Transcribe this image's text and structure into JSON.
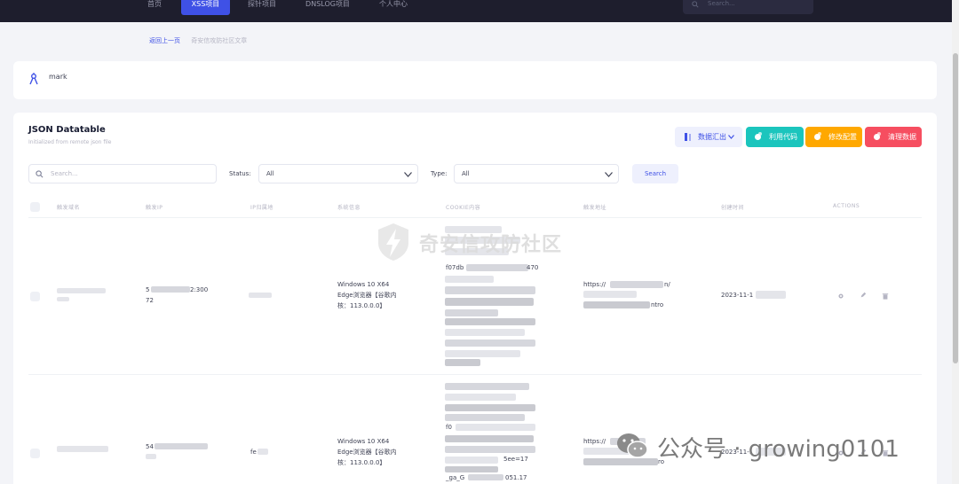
{
  "nav": {
    "items": [
      "首页",
      "XSS项目",
      "探针项目",
      "DNSLOG项目",
      "个人中心"
    ],
    "active_index": 1,
    "search_placeholder": "Search..."
  },
  "breadcrumb": {
    "back": "返回上一页",
    "current": "奇安信攻防社区文章"
  },
  "user": {
    "name": "mark"
  },
  "table": {
    "title": "JSON Datatable",
    "subtitle": "Initialized from remote json file",
    "buttons": {
      "summary": "数据汇出",
      "payload": "利用代码",
      "config": "修改配置",
      "clear": "清理数据"
    },
    "search_placeholder": "Search...",
    "status_label": "Status:",
    "status_value": "All",
    "type_label": "Type:",
    "type_value": "All",
    "search_button": "Search",
    "headers": [
      "触发域名",
      "触发IP",
      "IP归属地",
      "系统信息",
      "COOKIE内容",
      "触发地址",
      "创建时间",
      "ACTIONS"
    ],
    "rows": [
      {
        "ip_visible": "5",
        "ip_tail": "2:300",
        "ip_line2": "72",
        "system": [
          "Windows 10 X64",
          "Edge浏览器【谷歌内",
          "核：113.0.0.0】"
        ],
        "cookie_fragments": [
          "f07db",
          "470"
        ],
        "url_prefix": "https://",
        "url_suffix": "n/",
        "url_tail": "ntro",
        "time": "2023-11-1"
      },
      {
        "ip_visible": "54",
        "ip_tail": "",
        "location": "fe",
        "system": [
          "Windows 10 X64",
          "Edge浏览器【谷歌内",
          "核：113.0.0.0】"
        ],
        "cookie_fragments": [
          "f0",
          "_ga_G",
          "5ee=17",
          "051.17"
        ],
        "url_prefix": "https://",
        "url_tail": "ro",
        "time": "2023-11-1"
      }
    ]
  },
  "watermark": {
    "text": "奇安信攻防社区"
  },
  "wechat_footer": {
    "text": "公众号 · growing0101"
  },
  "colors": {
    "primary": "#3f51e6",
    "info": "#1bc5bd",
    "warning": "#ffa800",
    "danger": "#f64e60",
    "dark_nav": "#1e1e2d"
  }
}
